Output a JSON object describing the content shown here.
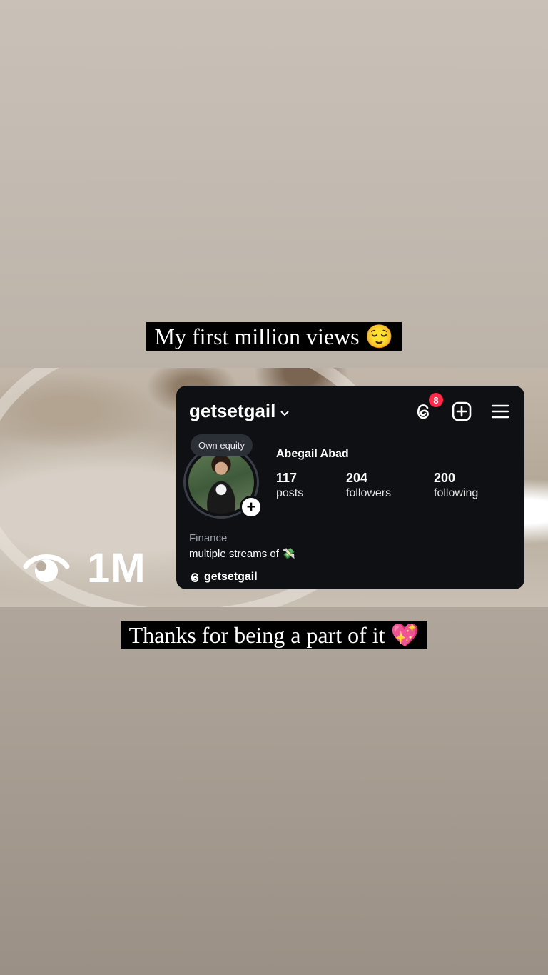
{
  "captions": {
    "top": "My first million views 😌",
    "bottom": "Thanks for being a part of it 💖"
  },
  "views": {
    "icon": "eye-views-icon",
    "count": "1M"
  },
  "profile": {
    "username": "getsetgail",
    "threads_badge_count": "8",
    "note": "Own equity",
    "full_name": "Abegail Abad",
    "stats": [
      {
        "number": "117",
        "label": "posts"
      },
      {
        "number": "204",
        "label": "followers"
      },
      {
        "number": "200",
        "label": "following"
      }
    ],
    "category": "Finance",
    "bio": "multiple streams of 💸",
    "threads_handle": "getsetgail"
  },
  "colors": {
    "card_bg": "#0e1014",
    "badge": "#ff2a4a",
    "caption_bg": "#000000"
  }
}
